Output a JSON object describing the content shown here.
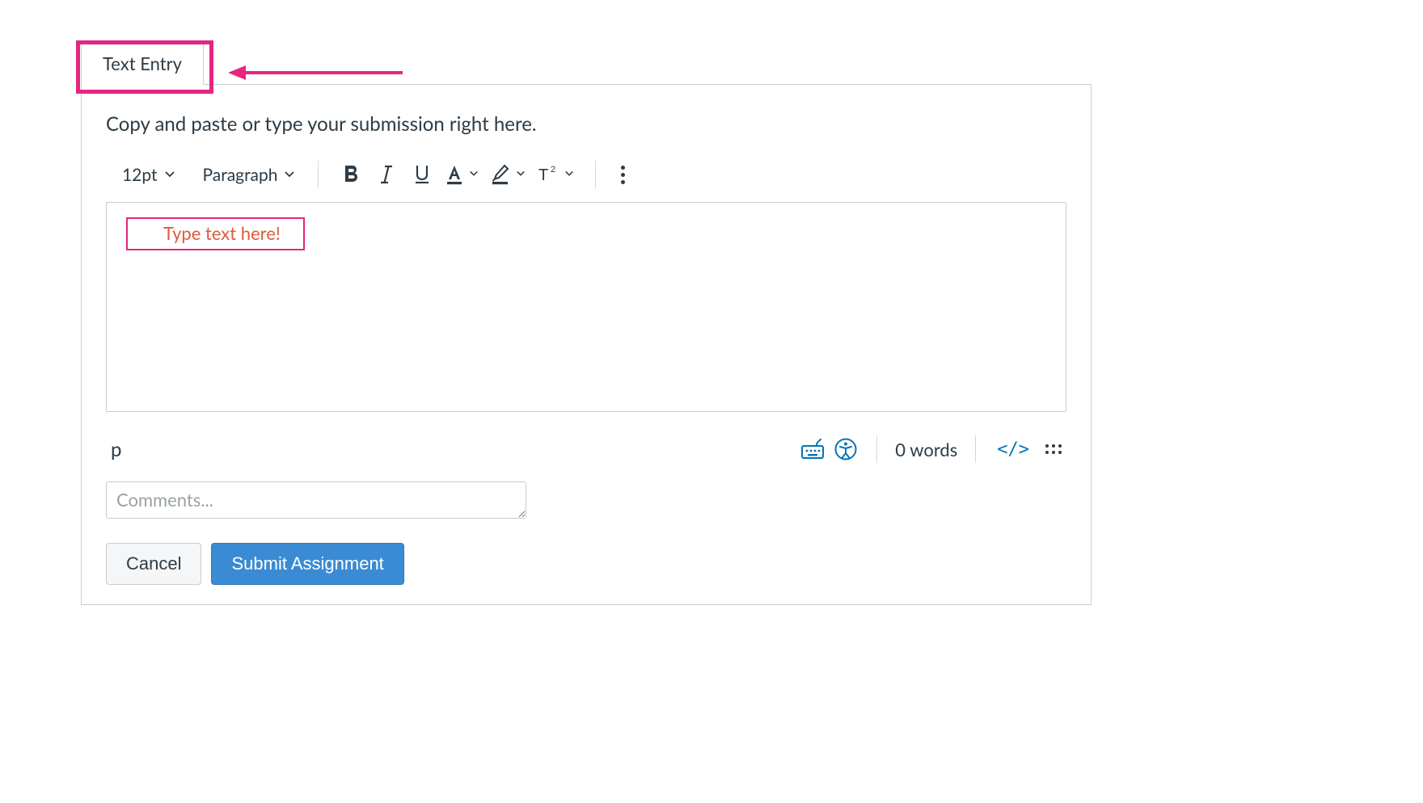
{
  "tab": {
    "label": "Text Entry"
  },
  "instruction": "Copy and paste or type your submission right here.",
  "toolbar": {
    "font_size": "12pt",
    "block_format": "Paragraph"
  },
  "editor": {
    "placeholder_annotation": "Type text here!"
  },
  "footer": {
    "path": "p",
    "word_count": "0 words",
    "code_toggle": "</>"
  },
  "comments": {
    "placeholder": "Comments..."
  },
  "buttons": {
    "cancel": "Cancel",
    "submit": "Submit Assignment"
  }
}
